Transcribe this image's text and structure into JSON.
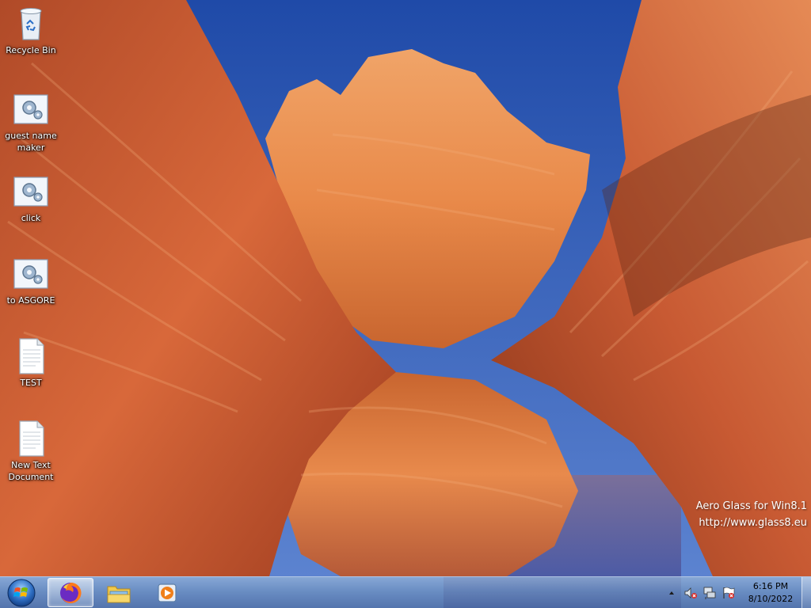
{
  "desktop": {
    "icons": [
      {
        "label": "Recycle Bin",
        "icon": "recycle-bin-icon"
      },
      {
        "label": "guest name maker",
        "icon": "batch-file-gear-icon"
      },
      {
        "label": "click",
        "icon": "batch-file-gear-icon"
      },
      {
        "label": "to ASGORE",
        "icon": "batch-file-gear-icon"
      },
      {
        "label": "TEST",
        "icon": "text-document-icon"
      },
      {
        "label": "New Text Document",
        "icon": "text-document-icon"
      }
    ],
    "watermark": {
      "line1": "Aero Glass for Win8.1",
      "line2": "http://www.glass8.eu"
    }
  },
  "taskbar": {
    "start_icon": "windows-start-orb-icon",
    "pinned": [
      {
        "name": "firefox",
        "icon": "firefox-icon",
        "active": true
      },
      {
        "name": "file-explorer",
        "icon": "folder-icon",
        "active": false
      },
      {
        "name": "media-player",
        "icon": "media-player-icon",
        "active": false
      }
    ],
    "tray": {
      "icons": [
        "chevron-up-icon",
        "speaker-muted-icon",
        "network-icon",
        "action-center-flag-icon"
      ],
      "time": "6:16 PM",
      "date": "8/10/2022"
    }
  },
  "colors": {
    "sky": "#2f58b4",
    "rock": "#d2683a",
    "text": "#ffffff"
  }
}
